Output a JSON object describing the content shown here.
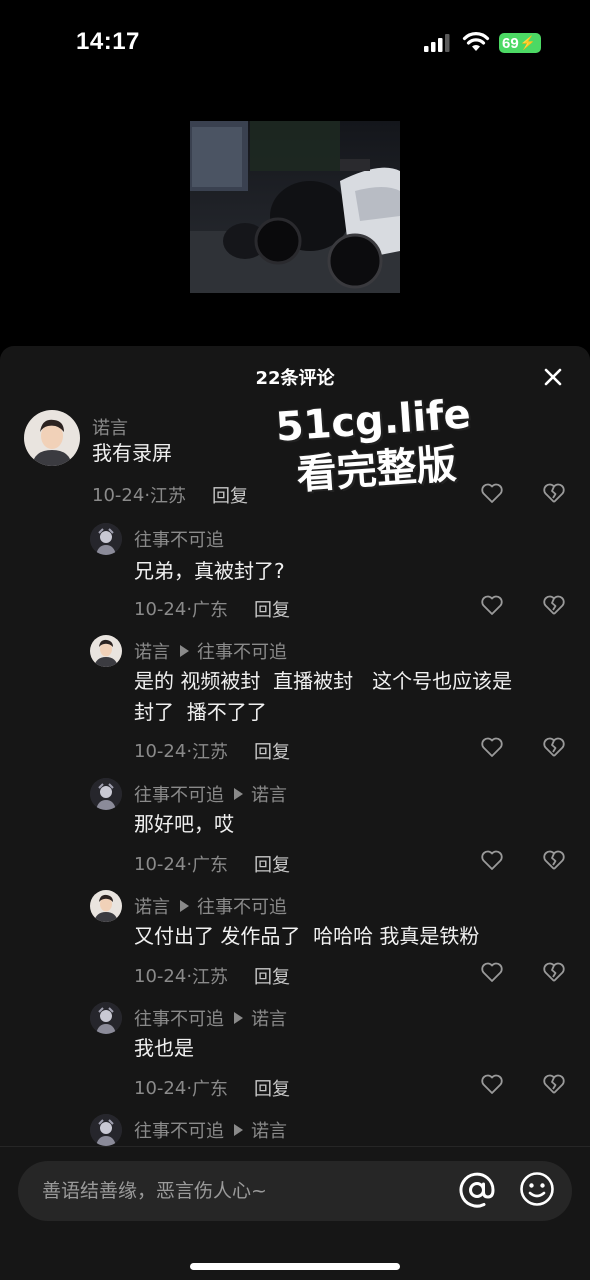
{
  "status_bar": {
    "time": "14:17",
    "battery": "69"
  },
  "sheet": {
    "title": "22条评论"
  },
  "watermark": {
    "line1": "51cg.life",
    "line2": "看完整版"
  },
  "comments": [
    {
      "author": "诺言",
      "reply_to": "",
      "text": "我有录屏",
      "date": "10-24",
      "location": "江苏",
      "reply_label": "回复"
    },
    {
      "author": "往事不可追",
      "reply_to": "",
      "text": "兄弟，真被封了?",
      "date": "10-24",
      "location": "广东",
      "reply_label": "回复"
    },
    {
      "author": "诺言",
      "reply_to": "往事不可追",
      "text": "是的 视频被封  直播被封   这个号也应该是\n封了  播不了了",
      "date": "10-24",
      "location": "江苏",
      "reply_label": "回复"
    },
    {
      "author": "往事不可追",
      "reply_to": "诺言",
      "text": "那好吧，哎",
      "date": "10-24",
      "location": "广东",
      "reply_label": "回复"
    },
    {
      "author": "诺言",
      "reply_to": "往事不可追",
      "text": "又付出了 发作品了  哈哈哈 我真是铁粉",
      "date": "10-24",
      "location": "江苏",
      "reply_label": "回复"
    },
    {
      "author": "往事不可追",
      "reply_to": "诺言",
      "text": "我也是",
      "date": "10-24",
      "location": "广东",
      "reply_label": "回复"
    },
    {
      "author": "往事不可追",
      "reply_to": "诺言"
    }
  ],
  "input": {
    "placeholder": "善语结善缘，恶言伤人心~"
  },
  "colors": {
    "sheet_bg": "#161616",
    "muted_text": "#8a8a8a",
    "battery_green": "#4cd964"
  }
}
